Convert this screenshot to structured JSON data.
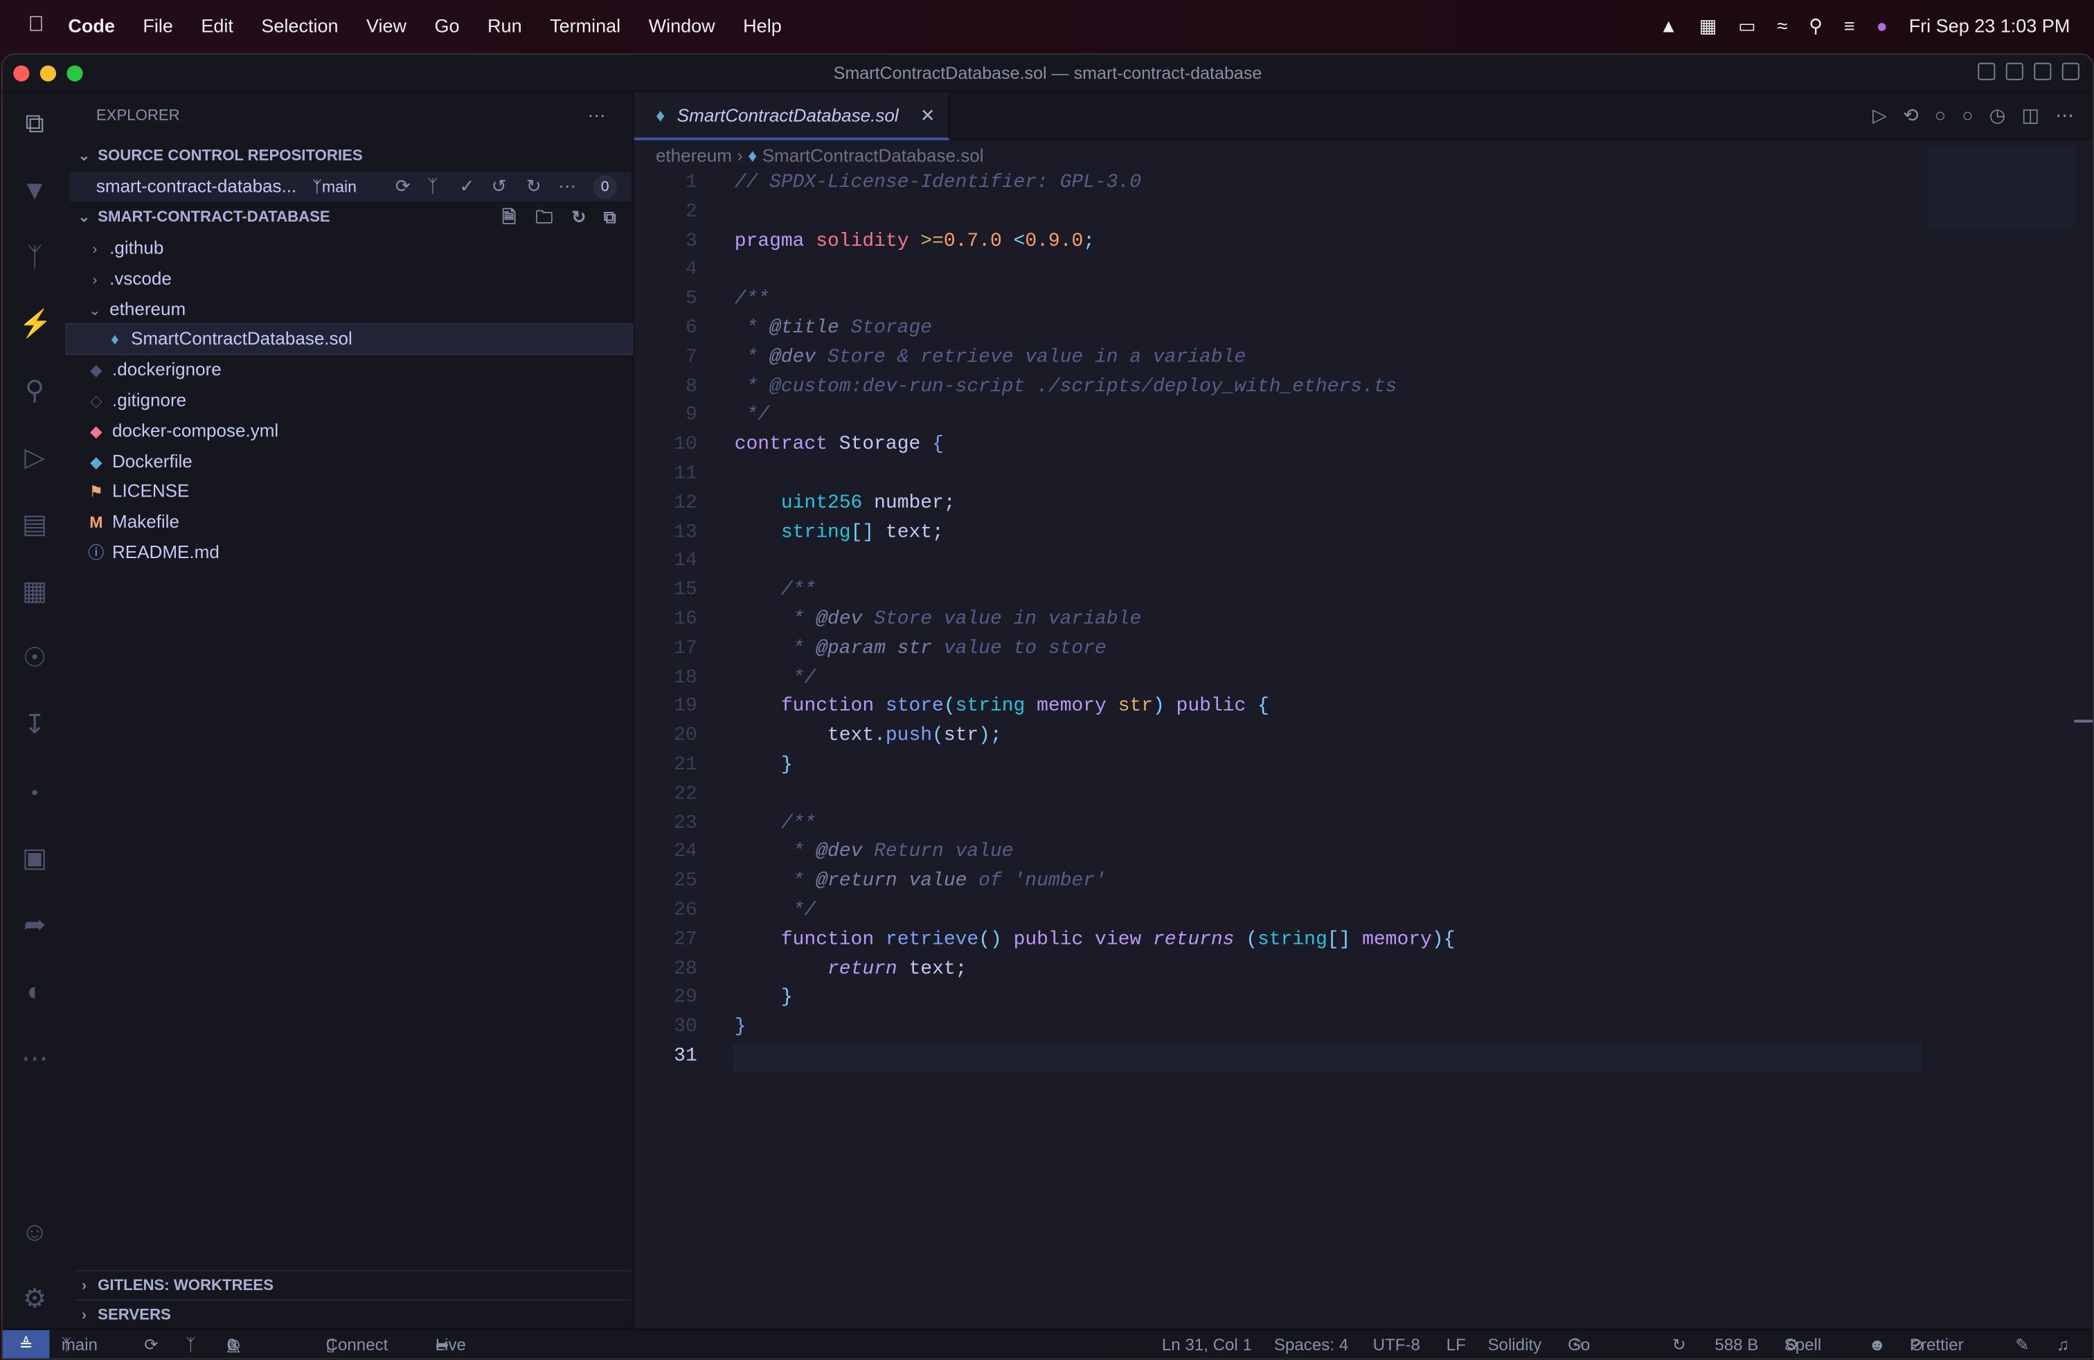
{
  "menubar": {
    "app": "Code",
    "items": [
      "File",
      "Edit",
      "Selection",
      "View",
      "Go",
      "Run",
      "Terminal",
      "Window",
      "Help"
    ],
    "clock": "Fri Sep 23  1:03 PM"
  },
  "window": {
    "title": "SmartContractDatabase.sol — smart-contract-database"
  },
  "sidebar": {
    "title": "EXPLORER",
    "scm_header": "SOURCE CONTROL REPOSITORIES",
    "repo": {
      "name": "smart-contract-databas...",
      "branch": "main",
      "changes": "0"
    },
    "folder_header": "SMART-CONTRACT-DATABASE",
    "tree": [
      {
        "label": ".github",
        "type": "folder",
        "icon": "chevron-right-icon"
      },
      {
        "label": ".vscode",
        "type": "folder",
        "icon": "chevron-right-icon"
      },
      {
        "label": "ethereum",
        "type": "folder-open",
        "icon": "chevron-down-icon"
      },
      {
        "label": "SmartContractDatabase.sol",
        "type": "file",
        "icon": "ethereum-icon",
        "color": "#5fa8d3",
        "selected": true
      },
      {
        "label": ".dockerignore",
        "type": "file",
        "icon": "docker-icon",
        "color": "#4f5370"
      },
      {
        "label": ".gitignore",
        "type": "file",
        "icon": "git-icon",
        "color": "#4f5370"
      },
      {
        "label": "docker-compose.yml",
        "type": "file",
        "icon": "docker-compose-icon",
        "color": "#f7768e"
      },
      {
        "label": "Dockerfile",
        "type": "file",
        "icon": "docker-icon",
        "color": "#5fa8d3"
      },
      {
        "label": "LICENSE",
        "type": "file",
        "icon": "license-icon",
        "color": "#e0af68"
      },
      {
        "label": "Makefile",
        "type": "file",
        "icon": "makefile-icon",
        "color": "#ff9e64"
      },
      {
        "label": "README.md",
        "type": "file",
        "icon": "info-icon",
        "color": "#7aa2f7"
      }
    ],
    "bottom_sections": [
      "GITLENS: WORKTREES",
      "SERVERS"
    ]
  },
  "editor": {
    "tab": "SmartContractDatabase.sol",
    "breadcrumb": [
      "ethereum",
      "SmartContractDatabase.sol"
    ],
    "current_line": 31,
    "lines": [
      [
        [
          "// SPDX-License-Identifier: GPL-3.0",
          "c"
        ]
      ],
      [],
      [
        [
          "pragma ",
          "k"
        ],
        [
          "solidity ",
          "p"
        ],
        [
          ">=",
          "y"
        ],
        [
          "0.7.0 ",
          "o"
        ],
        [
          "<",
          "b"
        ],
        [
          "0.9.0",
          "o"
        ],
        [
          ";",
          "b"
        ]
      ],
      [],
      [
        [
          "/**",
          "c"
        ]
      ],
      [
        [
          " * ",
          "c"
        ],
        [
          "@title",
          "ct"
        ],
        [
          " Storage",
          "c"
        ]
      ],
      [
        [
          " * ",
          "c"
        ],
        [
          "@dev",
          "ct"
        ],
        [
          " Store & retrieve value in a variable",
          "c"
        ]
      ],
      [
        [
          " * ",
          "c"
        ],
        [
          "@custom:dev-run-script ./scripts/deploy_with_ethers.ts",
          "c"
        ]
      ],
      [
        [
          " */",
          "c"
        ]
      ],
      [
        [
          "contract ",
          "k"
        ],
        [
          "Storage ",
          "v"
        ],
        [
          "{",
          "f"
        ]
      ],
      [],
      [
        [
          "    ",
          "v"
        ],
        [
          "uint256 ",
          "t"
        ],
        [
          "number;",
          "v"
        ]
      ],
      [
        [
          "    ",
          "v"
        ],
        [
          "string",
          "t"
        ],
        [
          "[] ",
          "b"
        ],
        [
          "text;",
          "v"
        ]
      ],
      [],
      [
        [
          "    /**",
          "c"
        ]
      ],
      [
        [
          "     * ",
          "c"
        ],
        [
          "@dev",
          "ct"
        ],
        [
          " Store value in variable",
          "c"
        ]
      ],
      [
        [
          "     * ",
          "c"
        ],
        [
          "@param str",
          "ct"
        ],
        [
          " value to store",
          "c"
        ]
      ],
      [
        [
          "     */",
          "c"
        ]
      ],
      [
        [
          "    ",
          "v"
        ],
        [
          "function ",
          "k"
        ],
        [
          "store",
          "f"
        ],
        [
          "(",
          "b"
        ],
        [
          "string ",
          "t"
        ],
        [
          "memory ",
          "k"
        ],
        [
          "str",
          "n"
        ],
        [
          ") ",
          "b"
        ],
        [
          "public ",
          "k"
        ],
        [
          "{",
          "b"
        ]
      ],
      [
        [
          "        text",
          "v"
        ],
        [
          ".",
          "b"
        ],
        [
          "push",
          "f"
        ],
        [
          "(",
          "b"
        ],
        [
          "str",
          "v"
        ],
        [
          ");",
          "b"
        ]
      ],
      [
        [
          "    ",
          "v"
        ],
        [
          "}",
          "b"
        ]
      ],
      [],
      [
        [
          "    /**",
          "c"
        ]
      ],
      [
        [
          "     * ",
          "c"
        ],
        [
          "@dev",
          "ct"
        ],
        [
          " Return value",
          "c"
        ]
      ],
      [
        [
          "     * ",
          "c"
        ],
        [
          "@return value",
          "ct"
        ],
        [
          " of 'number'",
          "c"
        ]
      ],
      [
        [
          "     */",
          "c"
        ]
      ],
      [
        [
          "    ",
          "v"
        ],
        [
          "function ",
          "k"
        ],
        [
          "retrieve",
          "f"
        ],
        [
          "() ",
          "b"
        ],
        [
          "public ",
          "k"
        ],
        [
          "view ",
          "k"
        ],
        [
          "returns ",
          "i"
        ],
        [
          "(",
          "b"
        ],
        [
          "string",
          "t"
        ],
        [
          "[] ",
          "b"
        ],
        [
          "memory",
          "k"
        ],
        [
          "){",
          "b"
        ]
      ],
      [
        [
          "        ",
          "v"
        ],
        [
          "return ",
          "i"
        ],
        [
          "text;",
          "v"
        ]
      ],
      [
        [
          "    ",
          "v"
        ],
        [
          "}",
          "b"
        ]
      ],
      [
        [
          "}",
          "f"
        ]
      ],
      []
    ]
  },
  "statusbar": {
    "branch": "main",
    "errors": "0",
    "warnings": "0",
    "connect": "Connect",
    "liveshare": "Live Share",
    "position": "Ln 31, Col 1",
    "spaces": "Spaces: 4",
    "encoding": "UTF-8",
    "eol": "LF",
    "language": "Solidity",
    "golive": "Go Live",
    "size": "588 B",
    "spell": "Spell",
    "prettier": "Prettier"
  }
}
